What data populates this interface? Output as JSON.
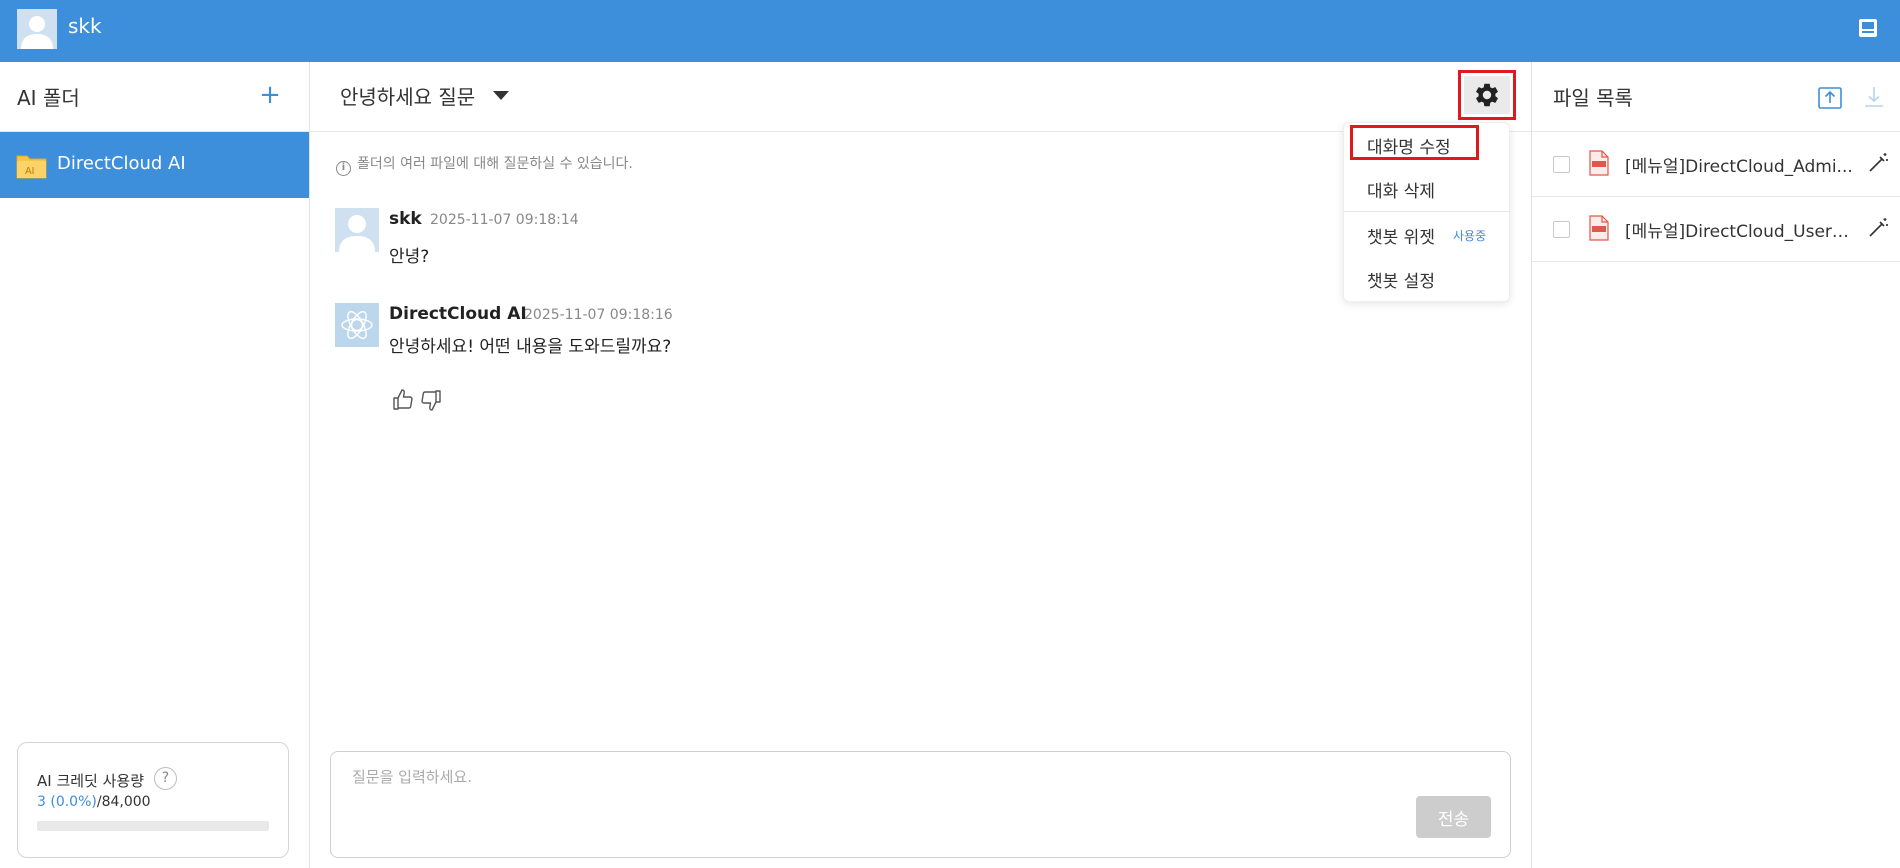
{
  "header": {
    "username": "skk"
  },
  "left": {
    "title": "AI 폴더",
    "add_label": "+",
    "folder": {
      "name": "DirectCloud AI",
      "icon": "ai-folder-icon"
    },
    "credit": {
      "title": "AI 크레딧 사용량",
      "help_label": "?",
      "used": "3 (0.0%)",
      "total": "/84,000",
      "fraction": 0.0
    }
  },
  "chat": {
    "title": "안녕하세요 질문",
    "notice": "폴더의 여러 파일에 대해 질문하실 수 있습니다.",
    "info_glyph": "i",
    "messages": [
      {
        "name": "skk",
        "time": "2025-11-07 09:18:14",
        "text": "안녕?"
      },
      {
        "name": "DirectCloud AI",
        "time": "2025-11-07 09:18:16",
        "text": "안녕하세요! 어떤 내용을 도와드릴까요?"
      }
    ],
    "input_placeholder": "질문을 입력하세요.",
    "send_label": "전송"
  },
  "menu": {
    "items": [
      {
        "label": "대화명 수정"
      },
      {
        "label": "대화 삭제"
      },
      {
        "label": "챗봇 위젯",
        "badge": "사용중"
      },
      {
        "label": "챗봇 설정"
      }
    ]
  },
  "files": {
    "title": "파일 목록",
    "items": [
      {
        "name": "[메뉴얼]DirectCloud_Admin_Manual.pdf",
        "display": "[메뉴얼]DirectCloud_Admi..."
      },
      {
        "name": "[메뉴얼]DirectCloud_User_Manual.pdf",
        "display": "[메뉴얼]DirectCloud_User_..."
      }
    ]
  },
  "colors": {
    "accent": "#3d8edb",
    "highlight": "#e0191f"
  }
}
